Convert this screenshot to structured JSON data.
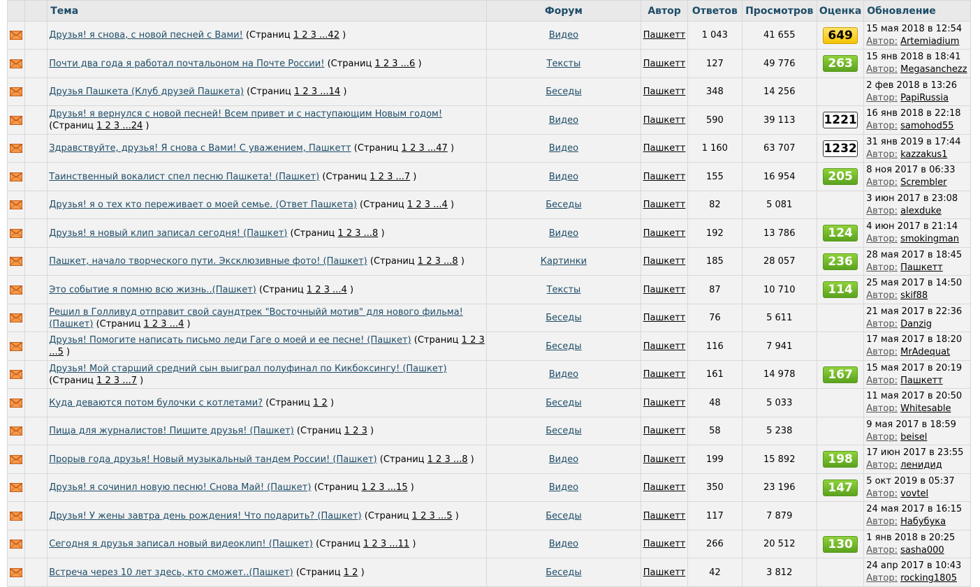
{
  "header": {
    "topic": "Тема",
    "forum": "Форум",
    "author": "Автор",
    "replies": "Ответов",
    "views": "Просмотров",
    "rating": "Оценка",
    "updated": "Обновление"
  },
  "labels": {
    "pages_prefix": "(Страниц",
    "pages_suffix": ")",
    "author_prefix": "Автор:"
  },
  "colors": {
    "header_text": "#1e4d68",
    "link": "#1e4d68",
    "badge_green": "#6ab42a",
    "badge_yellow": "#f5c400",
    "envelope": "#e8762b"
  },
  "icons": {
    "row_icon": "envelope-icon"
  },
  "rows": [
    {
      "title": "Друзья! я снова, с новой песней с Вами!",
      "pages": "1 2 3 ...42",
      "forum": "Видео",
      "author": "Пашкетт",
      "replies": "1 043",
      "views": "41 655",
      "rating": "649",
      "rating_style": "yellow",
      "date": "15 мая 2018 в 12:54",
      "last_user": "Artemiadium"
    },
    {
      "title": "Почти два года я работал почтальоном на Почте России!",
      "pages": "1 2 3 ...6",
      "forum": "Тексты",
      "author": "Пашкетт",
      "replies": "127",
      "views": "49 776",
      "rating": "263",
      "rating_style": "green",
      "date": "15 янв 2018 в 18:41",
      "last_user": "Megasanchezz"
    },
    {
      "title": "Друзья Пашкета (Клуб друзей Пашкета)",
      "pages": "1 2 3 ...14",
      "forum": "Беседы",
      "author": "Пашкетт",
      "replies": "348",
      "views": "14 256",
      "rating": "",
      "rating_style": "",
      "date": "2 фев 2018 в 13:26",
      "last_user": "PapiRussia"
    },
    {
      "title": "Друзья! я вернулся с новой песней! Всем привет и с наступающим Новым годом!",
      "pages": "1 2 3 ...24",
      "forum": "Видео",
      "author": "Пашкетт",
      "replies": "590",
      "views": "39 113",
      "rating": "1221",
      "rating_style": "white",
      "date": "16 янв 2018 в 22:18",
      "last_user": "samohod55"
    },
    {
      "title": "Здравствуйте, друзья! Я снова с Вами! С уважением, Пашкетт",
      "pages": "1 2 3 ...47",
      "forum": "Видео",
      "author": "Пашкетт",
      "replies": "1 160",
      "views": "63 707",
      "rating": "1232",
      "rating_style": "white",
      "date": "31 янв 2019 в 17:44",
      "last_user": "kazzakus1"
    },
    {
      "title": "Таинственный вокалист спел песню Пашкета! (Пашкет)",
      "pages": "1 2 3 ...7",
      "forum": "Видео",
      "author": "Пашкетт",
      "replies": "155",
      "views": "16 954",
      "rating": "205",
      "rating_style": "green",
      "date": "8 ноя 2017 в 06:33",
      "last_user": "Scrembler"
    },
    {
      "title": "Друзья! я о тех кто переживает о моей семье. (Ответ Пашкета)",
      "pages": "1 2 3 ...4",
      "forum": "Беседы",
      "author": "Пашкетт",
      "replies": "82",
      "views": "5 081",
      "rating": "",
      "rating_style": "",
      "date": "3 июн 2017 в 23:08",
      "last_user": "alexduke"
    },
    {
      "title": "Друзья! я новый клип записал сегодня! (Пашкет)",
      "pages": "1 2 3 ...8",
      "forum": "Видео",
      "author": "Пашкетт",
      "replies": "192",
      "views": "13 786",
      "rating": "124",
      "rating_style": "green",
      "date": "4 июн 2017 в 21:14",
      "last_user": "smokingman"
    },
    {
      "title": "Пашкет, начало творческого пути. Эксклюзивные фото! (Пашкет)",
      "pages": "1 2 3 ...8",
      "forum": "Картинки",
      "author": "Пашкетт",
      "replies": "185",
      "views": "28 057",
      "rating": "236",
      "rating_style": "green",
      "date": "28 мая 2017 в 18:45",
      "last_user": "Пашкетт"
    },
    {
      "title": "Это событие я помню всю жизнь..(Пашкет)",
      "pages": "1 2 3 ...4",
      "forum": "Тексты",
      "author": "Пашкетт",
      "replies": "87",
      "views": "10 710",
      "rating": "114",
      "rating_style": "green",
      "date": "25 мая 2017 в 14:50",
      "last_user": "skif88"
    },
    {
      "title": "Решил в Голливуд отправит свой саундтрек \"Восточныйй мотив\" для нового фильма! (Пашкет)",
      "pages": "1 2 3 ...4",
      "forum": "Беседы",
      "author": "Пашкетт",
      "replies": "76",
      "views": "5 611",
      "rating": "",
      "rating_style": "",
      "date": "21 мая 2017 в 22:36",
      "last_user": "Danzig"
    },
    {
      "title": "Друзья! Помогите написать письмо леди Гаге о моей и ее песне! (Пашкет)",
      "pages": "1 2 3 ...5",
      "forum": "Беседы",
      "author": "Пашкетт",
      "replies": "116",
      "views": "7 941",
      "rating": "",
      "rating_style": "",
      "date": "17 мая 2017 в 18:20",
      "last_user": "MrAdequat"
    },
    {
      "title": "Друзья! Мой старший средний сын выиграл полуфинал по Кикбоксингу! (Пашкет)",
      "pages": "1 2 3 ...7",
      "forum": "Видео",
      "author": "Пашкетт",
      "replies": "161",
      "views": "14 978",
      "rating": "167",
      "rating_style": "green",
      "date": "15 мая 2017 в 20:19",
      "last_user": "Пашкетт"
    },
    {
      "title": "Куда деваются потом булочки с котлетами?",
      "pages": "1 2",
      "forum": "Беседы",
      "author": "Пашкетт",
      "replies": "48",
      "views": "5 033",
      "rating": "",
      "rating_style": "",
      "date": "11 мая 2017 в 20:50",
      "last_user": "Whitesable"
    },
    {
      "title": "Пища для журналистов! Пишите друзья! (Пашкет)",
      "pages": "1 2 3",
      "forum": "Беседы",
      "author": "Пашкетт",
      "replies": "58",
      "views": "5 238",
      "rating": "",
      "rating_style": "",
      "date": "9 мая 2017 в 18:59",
      "last_user": "beisel"
    },
    {
      "title": "Прорыв года друзья! Новый музыкальный тандем России! (Пашкет)",
      "pages": "1 2 3 ...8",
      "forum": "Видео",
      "author": "Пашкетт",
      "replies": "199",
      "views": "15 892",
      "rating": "198",
      "rating_style": "green",
      "date": "17 июн 2017 в 23:55",
      "last_user": "ленидид"
    },
    {
      "title": "Друзья! я сочинил новую песню! Снова Май! (Пашкет)",
      "pages": "1 2 3 ...15",
      "forum": "Видео",
      "author": "Пашкетт",
      "replies": "350",
      "views": "23 196",
      "rating": "147",
      "rating_style": "green",
      "date": "5 окт 2019 в 05:37",
      "last_user": "vovtel"
    },
    {
      "title": "Друзья! У жены завтра день рождения! Что подарить? (Пашкет)",
      "pages": "1 2 3 ...5",
      "forum": "Беседы",
      "author": "Пашкетт",
      "replies": "117",
      "views": "7 879",
      "rating": "",
      "rating_style": "",
      "date": "24 мая 2017 в 16:15",
      "last_user": "Набубука"
    },
    {
      "title": "Сегодня я друзья записал новый видеоклип! (Пашкет)",
      "pages": "1 2 3 ...11",
      "forum": "Видео",
      "author": "Пашкетт",
      "replies": "266",
      "views": "20 512",
      "rating": "130",
      "rating_style": "green",
      "date": "1 янв 2018 в 20:25",
      "last_user": "sasha000"
    },
    {
      "title": "Встреча через 10 лет здесь, кто сможет..(Пашкет)",
      "pages": "1 2",
      "forum": "Беседы",
      "author": "Пашкетт",
      "replies": "42",
      "views": "3 812",
      "rating": "",
      "rating_style": "",
      "date": "24 апр 2017 в 10:43",
      "last_user": "rocking1805"
    }
  ]
}
